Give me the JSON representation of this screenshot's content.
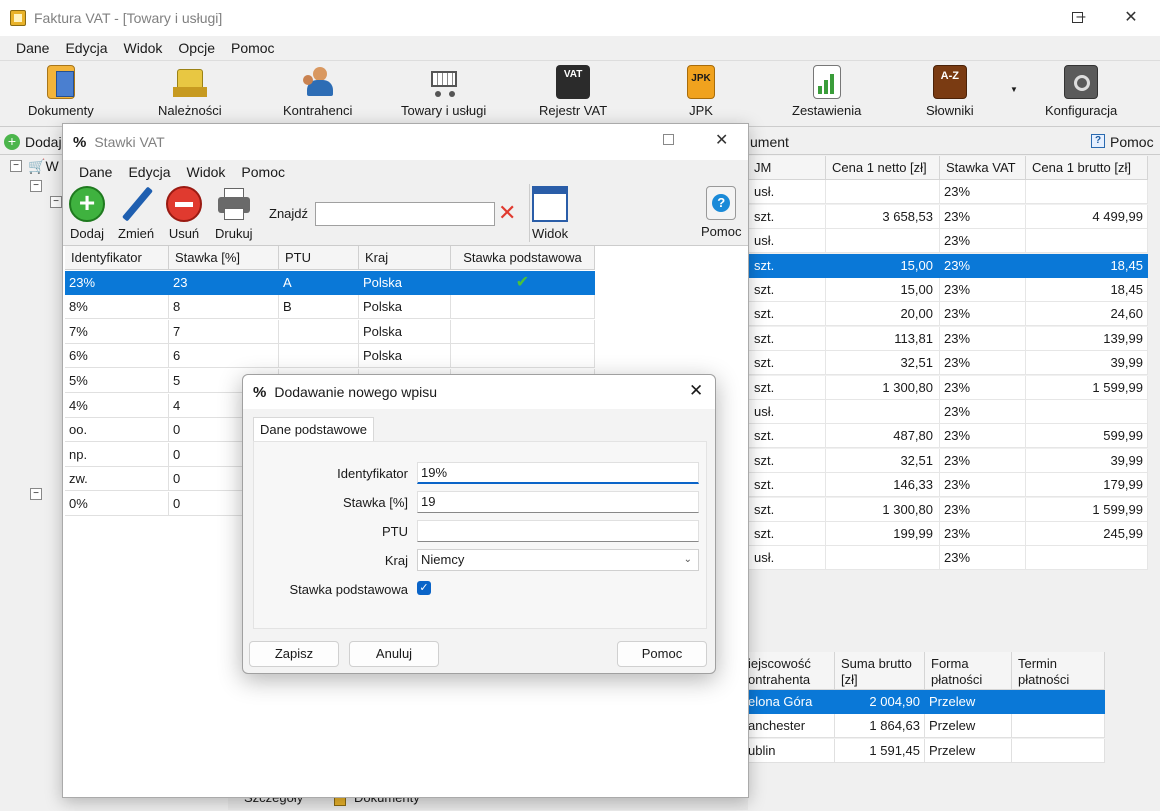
{
  "main_window": {
    "title": "Faktura VAT - [Towary i usługi]",
    "menu": [
      "Dane",
      "Edycja",
      "Widok",
      "Opcje",
      "Pomoc"
    ],
    "toolbar": [
      {
        "label": "Dokumenty",
        "icon": "documents-icon"
      },
      {
        "label": "Należności",
        "icon": "receivables-icon"
      },
      {
        "label": "Kontrahenci",
        "icon": "contractors-icon"
      },
      {
        "label": "Towary i usługi",
        "icon": "shopping-cart-icon"
      },
      {
        "label": "Rejestr VAT",
        "icon": "vat-register-icon",
        "badge": "VAT"
      },
      {
        "label": "JPK",
        "icon": "jpk-icon",
        "badge": "JPK"
      },
      {
        "label": "Zestawienia",
        "icon": "reports-icon"
      },
      {
        "label": "Słowniki",
        "icon": "dictionaries-icon",
        "badge": "A-Z"
      },
      {
        "label": "Konfiguracja",
        "icon": "settings-icon"
      }
    ],
    "second_bar": {
      "add_label": "Dodaj",
      "mid_label": "ument",
      "help_label": "Pomoc"
    },
    "tree_label": "W",
    "product_table": {
      "headers": {
        "jm": "JM",
        "netto": "Cena 1 netto [zł]",
        "stawka": "Stawka VAT",
        "brutto": "Cena 1 brutto [zł]"
      },
      "rows": [
        {
          "jm": "usł.",
          "netto": "",
          "stawka": "23%",
          "brutto": ""
        },
        {
          "jm": "szt.",
          "netto": "3 658,53",
          "stawka": "23%",
          "brutto": "4 499,99"
        },
        {
          "jm": "usł.",
          "netto": "",
          "stawka": "23%",
          "brutto": ""
        },
        {
          "jm": "szt.",
          "netto": "15,00",
          "stawka": "23%",
          "brutto": "18,45",
          "selected": true
        },
        {
          "jm": "szt.",
          "netto": "15,00",
          "stawka": "23%",
          "brutto": "18,45"
        },
        {
          "jm": "szt.",
          "netto": "20,00",
          "stawka": "23%",
          "brutto": "24,60"
        },
        {
          "jm": "szt.",
          "netto": "113,81",
          "stawka": "23%",
          "brutto": "139,99"
        },
        {
          "jm": "szt.",
          "netto": "32,51",
          "stawka": "23%",
          "brutto": "39,99"
        },
        {
          "jm": "szt.",
          "netto": "1 300,80",
          "stawka": "23%",
          "brutto": "1 599,99"
        },
        {
          "jm": "usł.",
          "netto": "",
          "stawka": "23%",
          "brutto": ""
        },
        {
          "jm": "szt.",
          "netto": "487,80",
          "stawka": "23%",
          "brutto": "599,99"
        },
        {
          "jm": "szt.",
          "netto": "32,51",
          "stawka": "23%",
          "brutto": "39,99"
        },
        {
          "jm": "szt.",
          "netto": "146,33",
          "stawka": "23%",
          "brutto": "179,99"
        },
        {
          "jm": "szt.",
          "netto": "1 300,80",
          "stawka": "23%",
          "brutto": "1 599,99"
        },
        {
          "jm": "szt.",
          "netto": "199,99",
          "stawka": "23%",
          "brutto": "245,99"
        },
        {
          "jm": "usł.",
          "netto": "",
          "stawka": "23%",
          "brutto": ""
        }
      ]
    },
    "document_table": {
      "headers": {
        "miejscowosc": "Miejscowość kontrahenta",
        "suma": "Suma brutto [zł]",
        "forma": "Forma płatności",
        "termin": "Termin płatności"
      },
      "header_visible": {
        "miejscowosc": [
          "iejscowość",
          "ontrahenta"
        ],
        "suma": [
          "Suma brutto",
          "[zł]"
        ],
        "forma": [
          "Forma",
          "płatności"
        ],
        "termin": [
          "Termin",
          "płatności"
        ]
      },
      "rows": [
        {
          "miejscowosc": "elona Góra",
          "suma": "2 004,90",
          "forma": "Przelew",
          "termin": "",
          "selected": true
        },
        {
          "miejscowosc": "anchester",
          "suma": "1 864,63",
          "forma": "Przelew",
          "termin": ""
        },
        {
          "miejscowosc": "ublin",
          "suma": "1 591,45",
          "forma": "Przelew",
          "termin": ""
        }
      ]
    },
    "bottom_tabs": [
      "Szczegóły",
      "Dokumenty"
    ]
  },
  "stawki_window": {
    "title": "Stawki VAT",
    "menu": [
      "Dane",
      "Edycja",
      "Widok",
      "Pomoc"
    ],
    "toolbar": {
      "dodaj": "Dodaj",
      "zmien": "Zmień",
      "usun": "Usuń",
      "drukuj": "Drukuj",
      "find_label": "Znajdź",
      "find_value": "",
      "widok": "Widok",
      "pomoc": "Pomoc"
    },
    "grid": {
      "headers": {
        "id": "Identyfikator",
        "stawka": "Stawka [%]",
        "ptu": "PTU",
        "kraj": "Kraj",
        "podstawowa": "Stawka podstawowa"
      },
      "rows": [
        {
          "id": "23%",
          "stawka": "23",
          "ptu": "A",
          "kraj": "Polska",
          "podstawowa": true,
          "selected": true
        },
        {
          "id": "8%",
          "stawka": "8",
          "ptu": "B",
          "kraj": "Polska",
          "podstawowa": false
        },
        {
          "id": "7%",
          "stawka": "7",
          "ptu": "",
          "kraj": "Polska",
          "podstawowa": false
        },
        {
          "id": "6%",
          "stawka": "6",
          "ptu": "",
          "kraj": "Polska",
          "podstawowa": false
        },
        {
          "id": "5%",
          "stawka": "5",
          "ptu": "",
          "kraj": "",
          "podstawowa": false
        },
        {
          "id": "4%",
          "stawka": "4",
          "ptu": "",
          "kraj": "",
          "podstawowa": false
        },
        {
          "id": "oo.",
          "stawka": "0",
          "ptu": "",
          "kraj": "",
          "podstawowa": false
        },
        {
          "id": "np.",
          "stawka": "0",
          "ptu": "",
          "kraj": "",
          "podstawowa": false
        },
        {
          "id": "zw.",
          "stawka": "0",
          "ptu": "",
          "kraj": "",
          "podstawowa": false
        },
        {
          "id": "0%",
          "stawka": "0",
          "ptu": "",
          "kraj": "",
          "podstawowa": false
        }
      ]
    }
  },
  "dialog": {
    "title": "Dodawanie nowego wpisu",
    "tab": "Dane podstawowe",
    "fields": {
      "identyfikator_label": "Identyfikator",
      "identyfikator_value": "19%",
      "stawka_label": "Stawka [%]",
      "stawka_value": "19",
      "ptu_label": "PTU",
      "ptu_value": "",
      "kraj_label": "Kraj",
      "kraj_value": "Niemcy",
      "podstawowa_label": "Stawka podstawowa",
      "podstawowa_checked": true
    },
    "buttons": {
      "zapisz": "Zapisz",
      "anuluj": "Anuluj",
      "pomoc": "Pomoc"
    }
  },
  "colors": {
    "selection": "#0a78d7",
    "accent": "#0a64c8"
  }
}
